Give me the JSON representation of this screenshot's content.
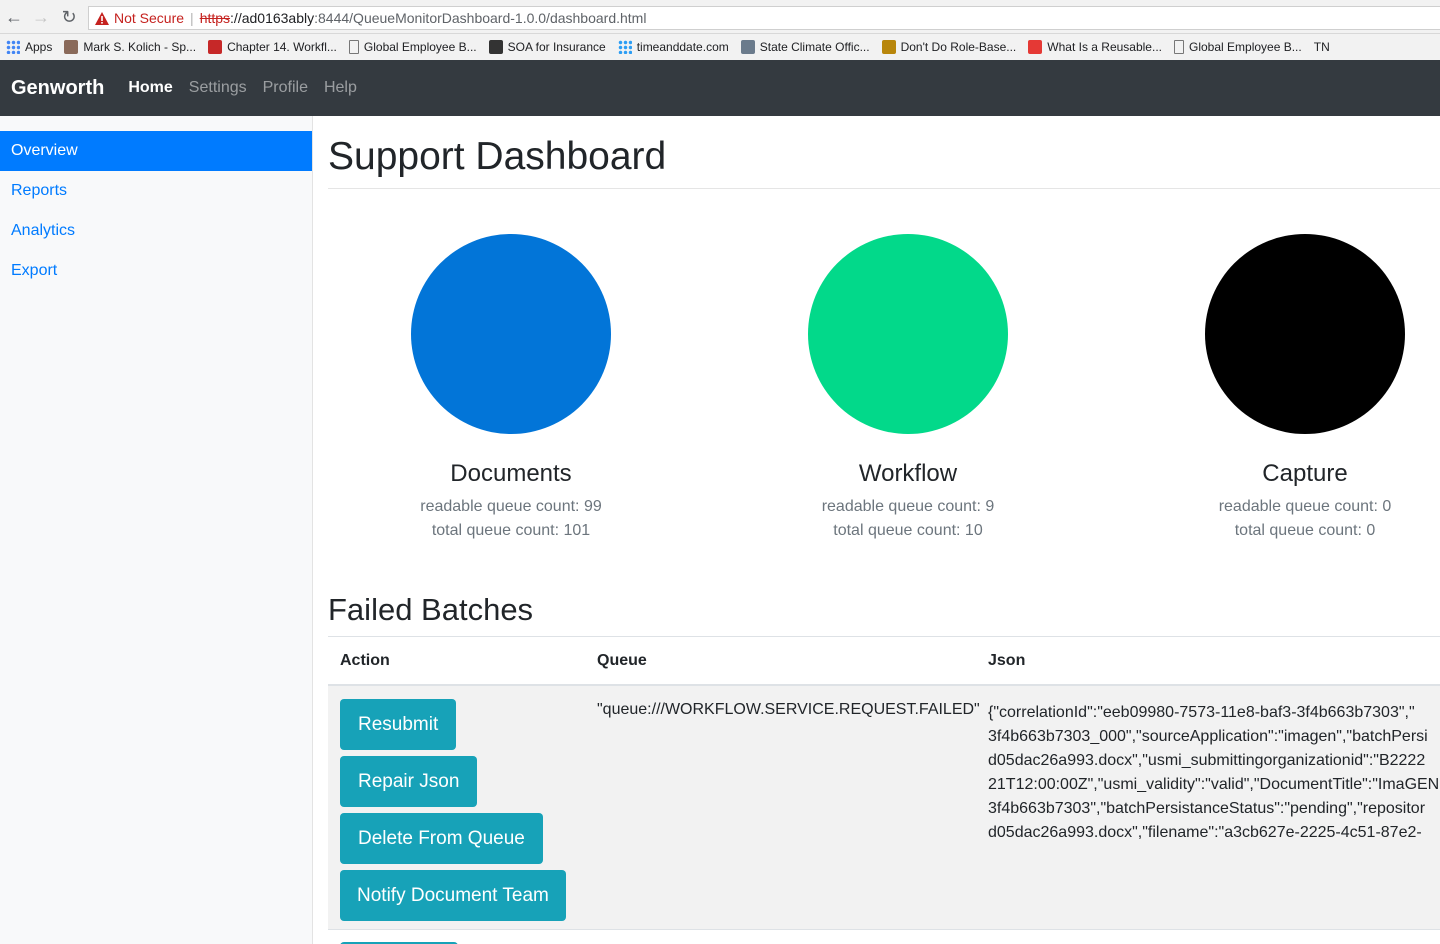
{
  "browser": {
    "not_secure": "Not Secure",
    "protocol": "https",
    "host": "://ad0163ably",
    "path": ":8444/QueueMonitorDashboard-1.0.0/dashboard.html",
    "bookmarks": [
      {
        "label": "Apps",
        "icon": "apps-grid-icon",
        "color": "#4285f4"
      },
      {
        "label": "Mark S. Kolich - Sp...",
        "icon": "avatar-icon",
        "color": "#8a6a5a"
      },
      {
        "label": "Chapter 14. Workfl...",
        "icon": "dr-logo-icon",
        "color": "#c62828"
      },
      {
        "label": "Global Employee B...",
        "icon": "page-icon",
        "color": "#777777"
      },
      {
        "label": "SOA for Insurance",
        "icon": "network-icon",
        "color": "#333333"
      },
      {
        "label": "timeanddate.com",
        "icon": "dots-icon",
        "color": "#2a9df4"
      },
      {
        "label": "State Climate Offic...",
        "icon": "climate-icon",
        "color": "#6b7b8c"
      },
      {
        "label": "Don't Do Role-Base...",
        "icon": "shield-icon",
        "color": "#b8860b"
      },
      {
        "label": "What Is a Reusable...",
        "icon": "oracle-icon",
        "color": "#e53935"
      },
      {
        "label": "Global Employee B...",
        "icon": "page-icon",
        "color": "#777777"
      },
      {
        "label": "TN",
        "icon": "",
        "color": "#333333"
      }
    ]
  },
  "navbar": {
    "brand": "Genworth",
    "links": [
      {
        "label": "Home",
        "active": true
      },
      {
        "label": "Settings",
        "active": false
      },
      {
        "label": "Profile",
        "active": false
      },
      {
        "label": "Help",
        "active": false
      }
    ]
  },
  "sidebar": {
    "items": [
      {
        "label": "Overview",
        "active": true
      },
      {
        "label": "Reports",
        "active": false
      },
      {
        "label": "Analytics",
        "active": false
      },
      {
        "label": "Export",
        "active": false
      }
    ]
  },
  "main": {
    "title": "Support Dashboard",
    "stats": [
      {
        "name": "Documents",
        "readable": "readable queue count: 99",
        "total": "total queue count: 101",
        "color": "#0275d8"
      },
      {
        "name": "Workflow",
        "readable": "readable queue count: 9",
        "total": "total queue count: 10",
        "color": "#02d98a"
      },
      {
        "name": "Capture",
        "readable": "readable queue count: 0",
        "total": "total queue count: 0",
        "color": "#000000"
      }
    ],
    "failed_title": "Failed Batches",
    "table": {
      "headers": {
        "action": "Action",
        "queue": "Queue",
        "json": "Json"
      },
      "row": {
        "buttons": [
          "Resubmit",
          "Repair Json",
          "Delete From Queue",
          "Notify Document Team"
        ],
        "queue": "\"queue:///WORKFLOW.SERVICE.REQUEST.FAILED\"",
        "json_lines": [
          "{\"correlationId\":\"eeb09980-7573-11e8-baf3-3f4b663b7303\",\"",
          "3f4b663b7303_000\",\"sourceApplication\":\"imagen\",\"batchPersi",
          "d05dac26a993.docx\",\"usmi_submittingorganizationid\":\"B2222",
          "21T12:00:00Z\",\"usmi_validity\":\"valid\",\"DocumentTitle\":\"ImaGEN",
          "3f4b663b7303\",\"batchPersistanceStatus\":\"pending\",\"repositor",
          "d05dac26a993.docx\",\"filename\":\"a3cb627e-2225-4c51-87e2-"
        ]
      }
    }
  }
}
